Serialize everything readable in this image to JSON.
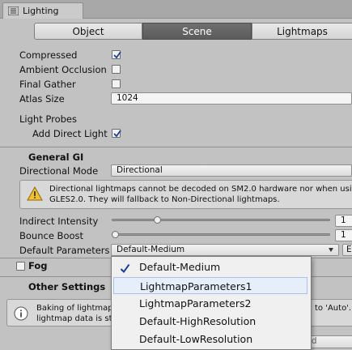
{
  "window": {
    "tab_title": "Lighting"
  },
  "tabs": [
    {
      "label": "Object"
    },
    {
      "label": "Scene"
    },
    {
      "label": "Lightmaps"
    }
  ],
  "lightmap_settings": {
    "compressed_label": "Compressed",
    "compressed_checked": true,
    "ambient_occlusion_label": "Ambient Occlusion",
    "ambient_occlusion_checked": false,
    "final_gather_label": "Final Gather",
    "final_gather_checked": false,
    "atlas_size_label": "Atlas Size",
    "atlas_size_value": "1024"
  },
  "light_probes": {
    "label": "Light Probes",
    "add_direct_light_label": "Add Direct Light",
    "add_direct_light_checked": true
  },
  "general_gi": {
    "header": "General GI",
    "directional_mode_label": "Directional Mode",
    "directional_mode_value": "Directional",
    "warning_line1": "Directional lightmaps cannot be decoded on SM2.0 hardware nor when using",
    "warning_line2": "GLES2.0. They will fallback to Non-Directional lightmaps.",
    "indirect_intensity_label": "Indirect Intensity",
    "indirect_intensity_value": "1",
    "indirect_intensity_fraction": 0.2,
    "bounce_boost_label": "Bounce Boost",
    "bounce_boost_value": "1",
    "bounce_boost_fraction": 0.0,
    "default_parameters_label": "Default Parameters",
    "default_parameters_value": "Default-Medium",
    "edit_button_label": "E"
  },
  "fog": {
    "label": "Fog",
    "checked": false
  },
  "other_settings": {
    "header": "Other Settings",
    "info_text_line1_left": "Baking of lightmap",
    "info_text_line1_right": "to 'Auto'. T",
    "info_text_line2_left": "lightmap data is st",
    "bottom_button_partial": "ild"
  },
  "dropdown": {
    "items": [
      {
        "label": "Default-Medium",
        "selected": true
      },
      {
        "label": "LightmapParameters1",
        "selected": false
      },
      {
        "label": "LightmapParameters2",
        "selected": false
      },
      {
        "label": "Default-HighResolution",
        "selected": false
      },
      {
        "label": "Default-LowResolution",
        "selected": false
      }
    ]
  },
  "colors": {
    "panel": "#c2c2c2",
    "active_tab": "#5f5f5f",
    "check": "#1a3f9a",
    "highlight": "#e6eefa"
  }
}
